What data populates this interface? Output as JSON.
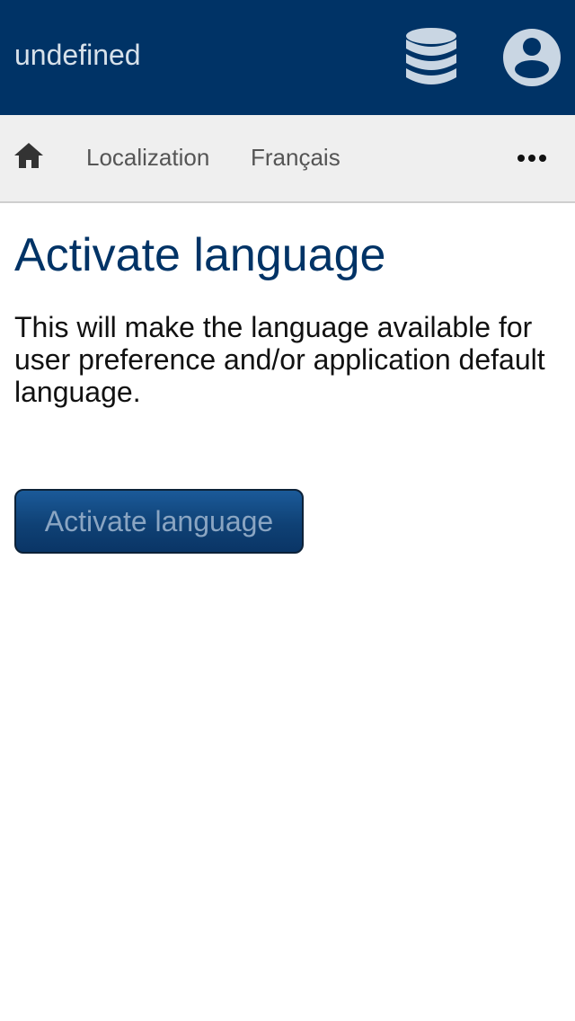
{
  "header": {
    "app_title": "undefined",
    "icons": {
      "database": "database-icon",
      "user": "user-circle-icon"
    },
    "background_color": "#003366"
  },
  "breadcrumb": {
    "home_icon": "home-icon",
    "items": [
      {
        "label": "Localization"
      },
      {
        "label": "Français"
      }
    ],
    "more_icon": "more-horizontal-icon"
  },
  "main": {
    "title": "Activate language",
    "description": "This will make the language available for user preference and/or application default language.",
    "activate_button_label": "Activate language"
  },
  "colors": {
    "brand": "#003366",
    "button_text": "#8aa5c2",
    "breadcrumb_bg": "#efefef"
  }
}
